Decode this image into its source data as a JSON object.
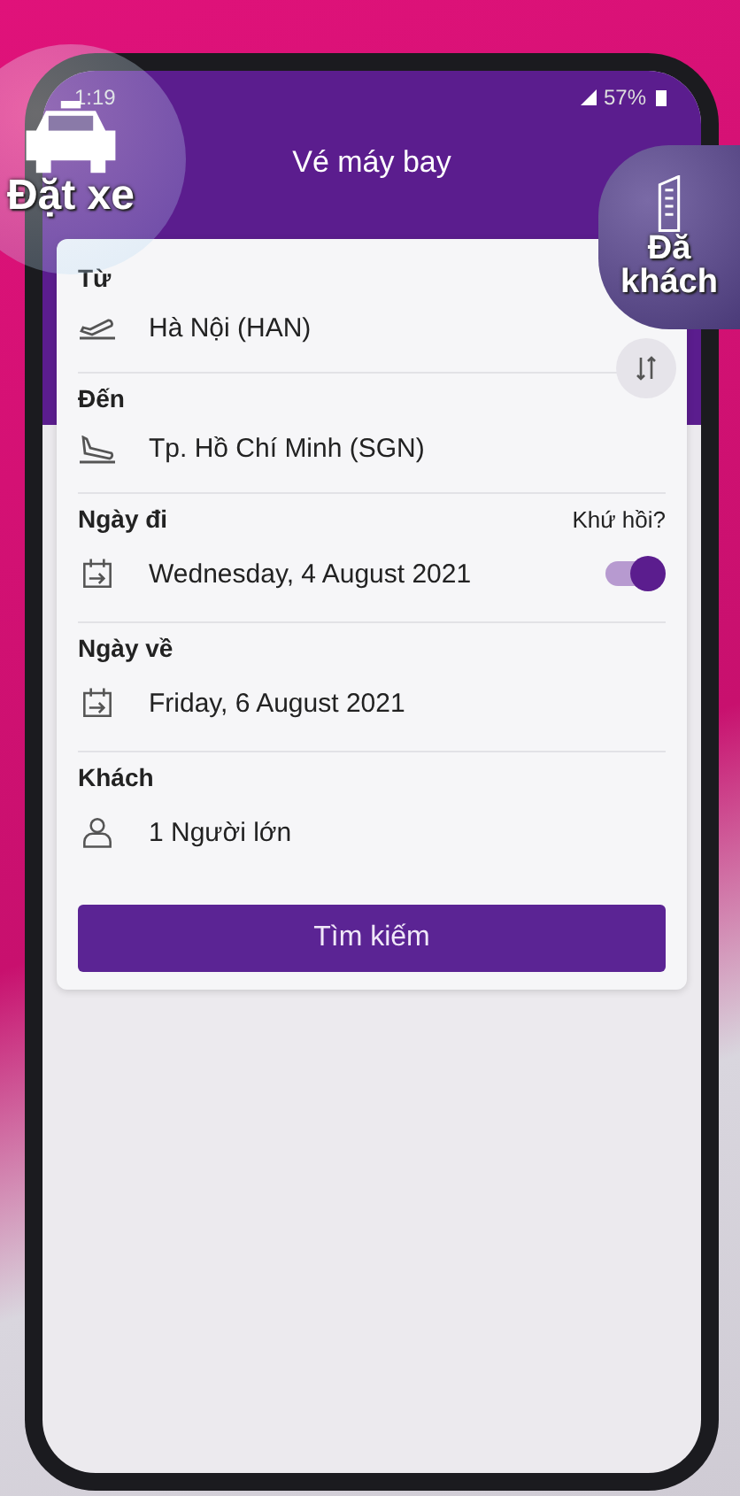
{
  "status_bar": {
    "time": "1:19",
    "battery": "57%"
  },
  "header": {
    "title": "Vé máy bay"
  },
  "from": {
    "label": "Từ",
    "value": "Hà Nội (HAN)"
  },
  "to": {
    "label": "Đến",
    "value": "Tp. Hồ Chí Minh (SGN)"
  },
  "depart": {
    "label": "Ngày đi",
    "value": "Wednesday, 4 August 2021"
  },
  "round_trip": {
    "label": "Khứ hồi?",
    "on": true
  },
  "return": {
    "label": "Ngày về",
    "value": "Friday, 6 August 2021"
  },
  "passengers": {
    "label": "Khách",
    "value": "1 Người lớn"
  },
  "search_button": {
    "label": "Tìm kiếm"
  },
  "bubbles": [
    {
      "kind": "car",
      "lines": [
        "Đặt xe"
      ]
    },
    {
      "kind": "building",
      "lines": [
        "Đă",
        "khách"
      ]
    }
  ]
}
